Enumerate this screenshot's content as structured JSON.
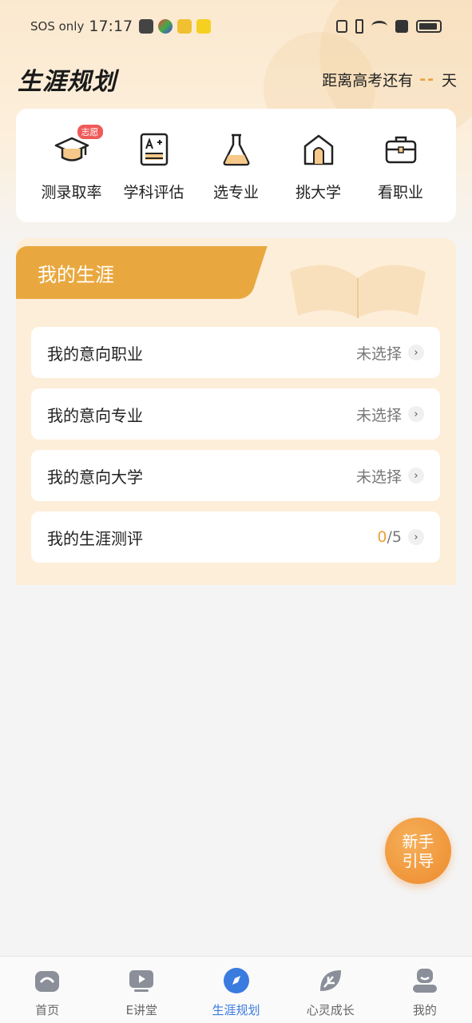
{
  "status_bar": {
    "carrier": "SOS only",
    "time": "17:17"
  },
  "header": {
    "title": "生涯规划",
    "countdown_prefix": "距离高考还有",
    "countdown_days": "--",
    "countdown_suffix": "天"
  },
  "quick_actions": [
    {
      "label": "测录取率",
      "icon": "graduation-cap-icon",
      "badge": "志愿"
    },
    {
      "label": "学科评估",
      "icon": "grade-report-icon"
    },
    {
      "label": "选专业",
      "icon": "flask-icon"
    },
    {
      "label": "挑大学",
      "icon": "school-building-icon"
    },
    {
      "label": "看职业",
      "icon": "briefcase-icon"
    }
  ],
  "career_panel": {
    "title": "我的生涯",
    "rows": [
      {
        "label": "我的意向职业",
        "value": "未选择"
      },
      {
        "label": "我的意向专业",
        "value": "未选择"
      },
      {
        "label": "我的意向大学",
        "value": "未选择"
      },
      {
        "label": "我的生涯测评",
        "value_current": "0",
        "value_total": "/5"
      }
    ]
  },
  "guide_button": {
    "line1": "新手",
    "line2": "引导"
  },
  "tab_bar": {
    "active": "生涯规划",
    "items": [
      {
        "label": "首页",
        "icon": "home-icon"
      },
      {
        "label": "E讲堂",
        "icon": "video-play-icon"
      },
      {
        "label": "生涯规划",
        "icon": "compass-icon"
      },
      {
        "label": "心灵成长",
        "icon": "leaf-icon"
      },
      {
        "label": "我的",
        "icon": "profile-icon"
      }
    ]
  },
  "colors": {
    "accent": "#e9a83f",
    "active_tab": "#3a7be0",
    "badge": "#ef5a58"
  }
}
